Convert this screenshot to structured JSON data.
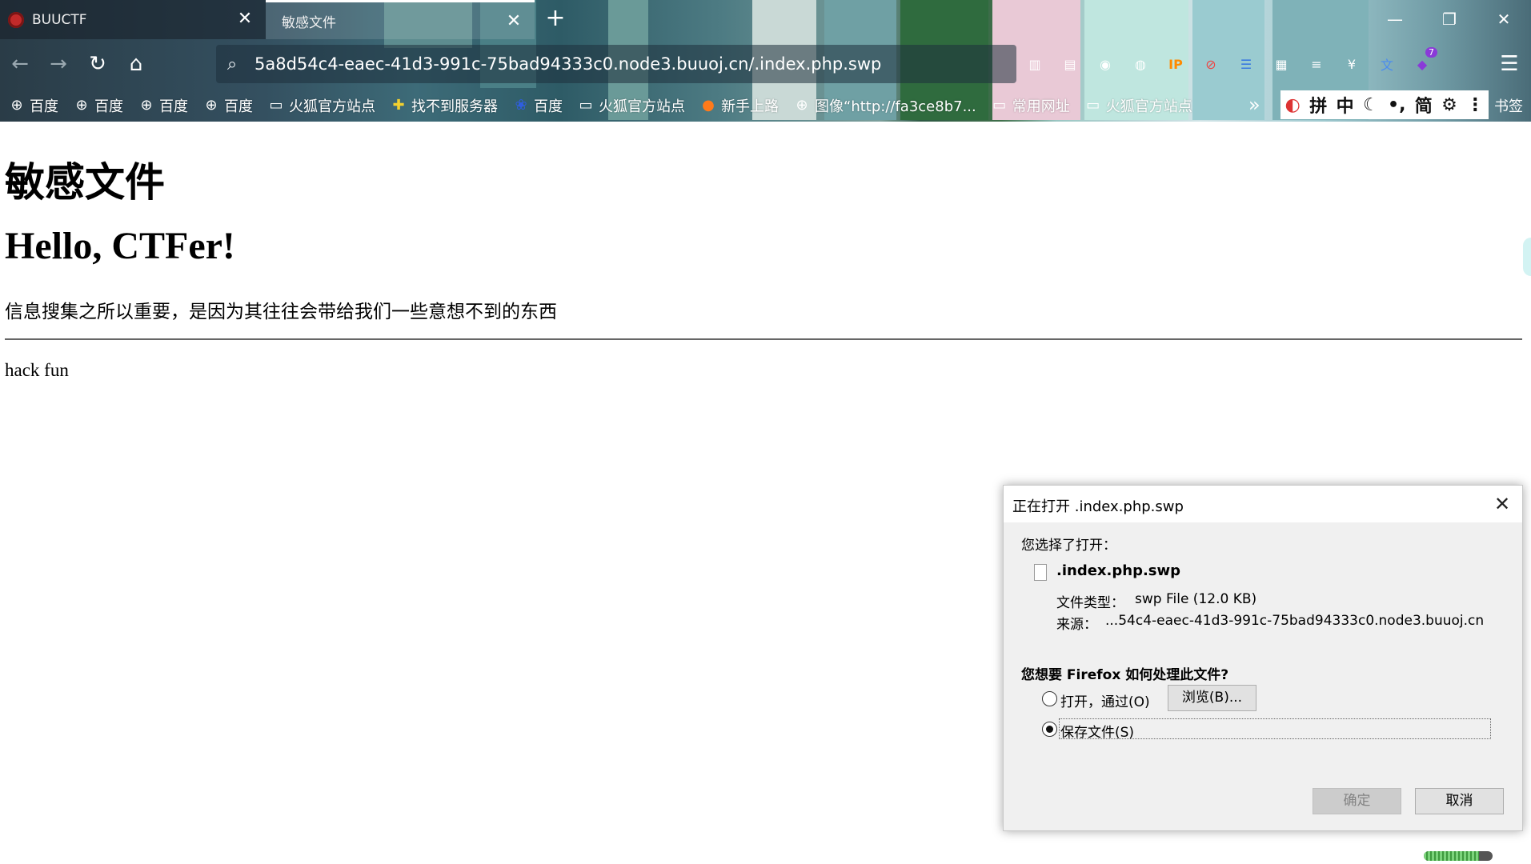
{
  "browser": {
    "tabs": [
      {
        "title": "BUUCTF"
      },
      {
        "title": "敏感文件"
      }
    ],
    "url": "5a8d54c4-eaec-41d3-991c-75bad94333c0.node3.buuoj.cn/.index.php.swp",
    "extension_badge": "7",
    "bookmarks": [
      {
        "label": "百度",
        "icon": "globe-icon"
      },
      {
        "label": "百度",
        "icon": "globe-icon"
      },
      {
        "label": "百度",
        "icon": "globe-icon"
      },
      {
        "label": "百度",
        "icon": "globe-icon"
      },
      {
        "label": "火狐官方站点",
        "icon": "folder-icon"
      },
      {
        "label": "找不到服务器",
        "icon": "plus-icon"
      },
      {
        "label": "百度",
        "icon": "paw-icon"
      },
      {
        "label": "火狐官方站点",
        "icon": "folder-icon"
      },
      {
        "label": "新手上路",
        "icon": "firefox-icon"
      },
      {
        "label": "图像“http://fa3ce8b7...",
        "icon": "globe-icon"
      },
      {
        "label": "常用网址",
        "icon": "folder-icon"
      },
      {
        "label": "火狐官方站点",
        "icon": "folder-icon"
      }
    ],
    "ime": [
      "拼",
      "中",
      "简"
    ],
    "bookmarks_menu_label": "书签"
  },
  "page": {
    "title": "敏感文件",
    "hello": "Hello, CTFer!",
    "info": "信息搜集之所以重要，是因为其往往会带给我们一些意想不到的东西",
    "hack": "hack fun"
  },
  "dialog": {
    "title": "正在打开 .index.php.swp",
    "chosen_label": "您选择了打开：",
    "filename": ".index.php.swp",
    "type_label": "文件类型：",
    "type_value": "swp File (12.0 KB)",
    "source_label": "来源：",
    "source_value": "...54c4-eaec-41d3-991c-75bad94333c0.node3.buuoj.cn",
    "question": "您想要 Firefox 如何处理此文件?",
    "open_label": "打开，通过(O)",
    "browse_label": "浏览(B)...",
    "save_label": "保存文件(S)",
    "ok_label": "确定",
    "cancel_label": "取消",
    "selected_option": "save"
  },
  "download_progress": 0.8
}
